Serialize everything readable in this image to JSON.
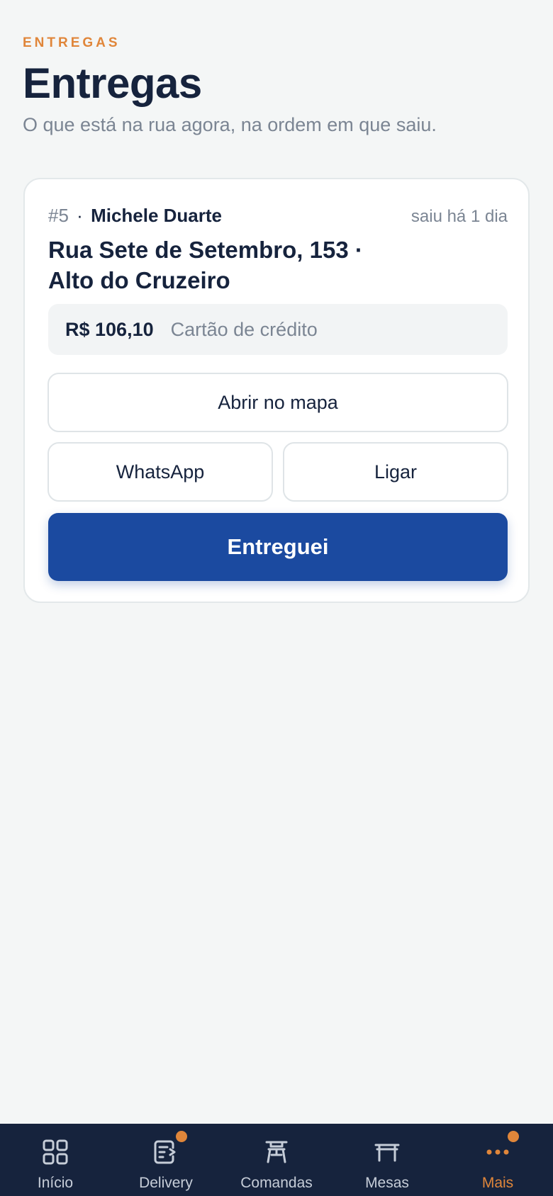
{
  "header": {
    "eyebrow": "ENTREGAS",
    "title": "Entregas",
    "subtitle": "O que está na rua agora, na ordem em que saiu."
  },
  "delivery": {
    "order_number": "#5",
    "separator": "·",
    "customer": "Michele Duarte",
    "time_ago": "saiu há 1 dia",
    "address": "Rua Sete de Setembro, 153 · Alto do Cruzeiro",
    "amount": "R$ 106,10",
    "payment_method": "Cartão de crédito",
    "open_map_label": "Abrir no mapa",
    "whatsapp_label": "WhatsApp",
    "call_label": "Ligar",
    "delivered_label": "Entreguei"
  },
  "tabbar": {
    "items": [
      {
        "label": "Início",
        "icon": "grid-icon",
        "active": false,
        "badge": false
      },
      {
        "label": "Delivery",
        "icon": "delivery-icon",
        "active": false,
        "badge": true
      },
      {
        "label": "Comandas",
        "icon": "order-ticket-icon",
        "active": false,
        "badge": false
      },
      {
        "label": "Mesas",
        "icon": "table-icon",
        "active": false,
        "badge": false
      },
      {
        "label": "Mais",
        "icon": "more-dots-icon",
        "active": true,
        "badge": true
      }
    ]
  },
  "colors": {
    "accent": "#e0863a",
    "primary": "#1b4aa0",
    "navy": "#16233d",
    "muted": "#7b8593"
  }
}
